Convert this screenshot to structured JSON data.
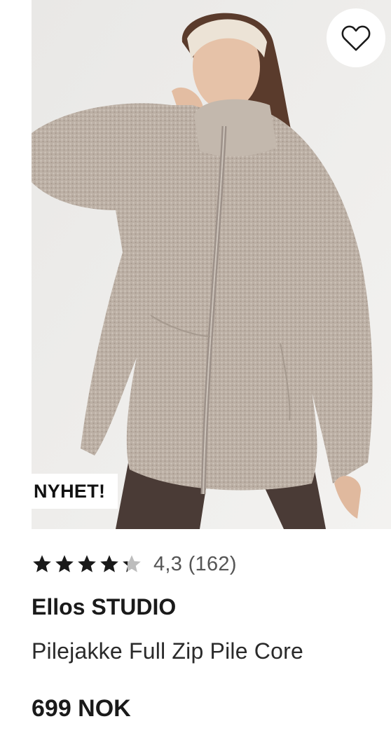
{
  "product": {
    "badge": "NYHET!",
    "rating": {
      "stars": 4.3,
      "max_stars": 5,
      "text": "4,3 (162)"
    },
    "brand": "Ellos STUDIO",
    "title": "Pilejakke Full Zip Pile Core",
    "price": "699 NOK",
    "image_alt": "model wearing beige teddy fleece full-zip jacket",
    "wishlist_icon": "heart-outline-icon"
  },
  "colors": {
    "text": "#1a1a1a",
    "rating_text": "#555555",
    "star": "#1a1a1a",
    "star_empty": "#bdbdbd",
    "jacket": "#bcb0a5",
    "background": "#eeeeed"
  }
}
